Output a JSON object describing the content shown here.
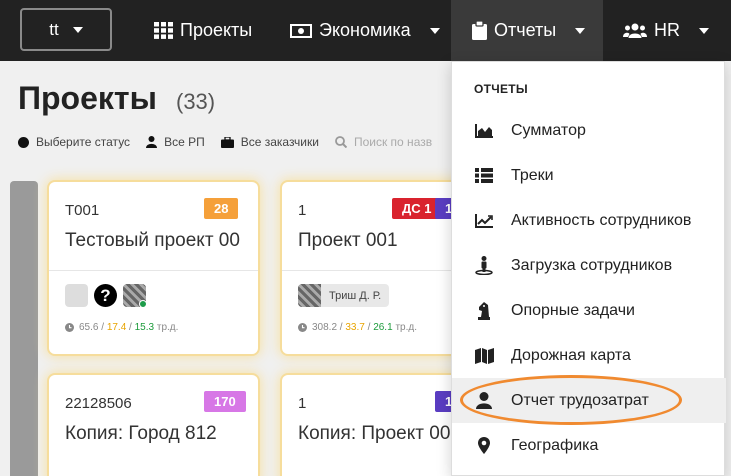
{
  "workspace": {
    "label": "tt"
  },
  "nav": {
    "projects": "Проекты",
    "economics": "Экономика",
    "reports": "Отчеты",
    "hr": "HR"
  },
  "page": {
    "title": "Проекты",
    "count": "(33)"
  },
  "filters": {
    "status": "Выберите статус",
    "managers": "Все РП",
    "clients": "Все заказчики",
    "search_placeholder": "Поиск по назв"
  },
  "cards": [
    {
      "code": "T001",
      "title": "Тестовый проект 00",
      "badges": [
        {
          "text": "28",
          "color": "#f5a03a"
        }
      ],
      "stats": {
        "a": "65.6",
        "b": "17.4",
        "c": "15.3",
        "unit": "тр.д."
      }
    },
    {
      "code": "1",
      "title": "Проект 001",
      "badges": [
        {
          "text": "ДС 1",
          "color": "#d9232e"
        },
        {
          "text": "1",
          "color": "#5a3dc2"
        }
      ],
      "person": "Триш Д. Р.",
      "stats": {
        "a": "308.2",
        "b": "33.7",
        "c": "26.1",
        "unit": "тр.д."
      }
    },
    {
      "code": "22128506",
      "title": "Копия: Город 812",
      "badges": [
        {
          "text": "170",
          "color": "#d777e6"
        }
      ]
    },
    {
      "code": "1",
      "title": "Копия: Проект 00",
      "badges": [
        {
          "text": "1",
          "color": "#5a3dc2"
        }
      ]
    }
  ],
  "dropdown": {
    "header": "ОТЧЕТЫ",
    "items": [
      {
        "label": "Сумматор",
        "icon": "area-chart-icon"
      },
      {
        "label": "Треки",
        "icon": "list-icon"
      },
      {
        "label": "Активность сотрудников",
        "icon": "line-chart-icon"
      },
      {
        "label": "Загрузка сотрудников",
        "icon": "street-view-icon"
      },
      {
        "label": "Опорные задачи",
        "icon": "chess-knight-icon"
      },
      {
        "label": "Дорожная карта",
        "icon": "map-icon"
      },
      {
        "label": "Отчет трудозатрат",
        "icon": "user-icon"
      },
      {
        "label": "Географика",
        "icon": "map-marker-icon"
      }
    ]
  },
  "colors": {
    "navbar": "#222222",
    "highlight": "#f08a30"
  }
}
